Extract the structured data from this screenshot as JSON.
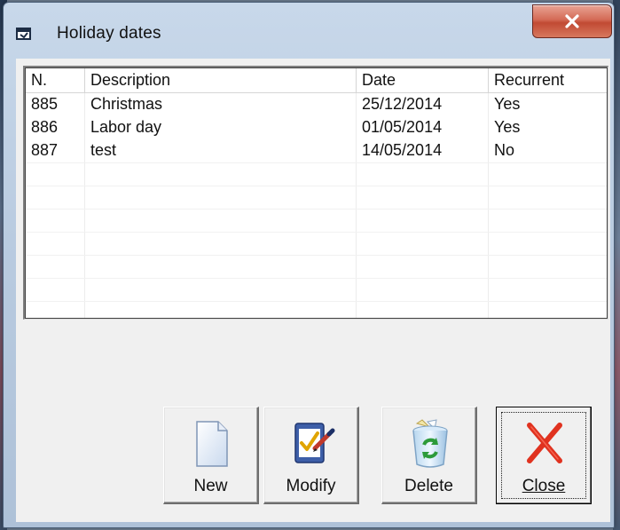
{
  "window": {
    "title": "Holiday dates",
    "close_glyph": "x",
    "icon": "window-app-icon"
  },
  "table": {
    "columns": [
      "N.",
      "Description",
      "Date",
      "Recurrent"
    ],
    "rows": [
      {
        "n": "885",
        "description": "Christmas",
        "date": "25/12/2014",
        "recurrent": "Yes"
      },
      {
        "n": "886",
        "description": "Labor day",
        "date": "01/05/2014",
        "recurrent": "Yes"
      },
      {
        "n": "887",
        "description": "test",
        "date": "14/05/2014",
        "recurrent": "No"
      }
    ]
  },
  "buttons": {
    "new": {
      "label": "New",
      "icon": "new-document-icon"
    },
    "modify": {
      "label": "Modify",
      "icon": "modify-checklist-icon"
    },
    "delete": {
      "label": "Delete",
      "icon": "recycle-bin-icon"
    },
    "close": {
      "label": "Close",
      "icon": "red-x-icon"
    }
  },
  "colors": {
    "close_accent": "#d8553f",
    "selection_focus": "#222222"
  }
}
